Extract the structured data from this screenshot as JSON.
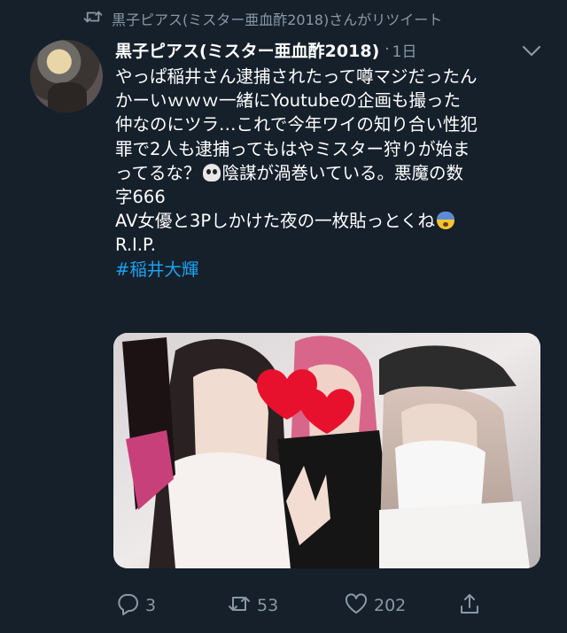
{
  "retweet_banner": {
    "text": "黒子ピアス(ミスター亜血酢2018)さんがリツイート",
    "icon": "retweet-icon"
  },
  "tweet": {
    "author_name": "黒子ピアス(ミスター亜血酢2018)",
    "separator": "·",
    "time": "1日",
    "text_lines": [
      "やっぱ稲井さん逮捕されたって噂マジだったん",
      "かーいｗｗｗ一緒にYoutubeの企画も撮った",
      "仲なのにツラ…これで今年ワイの知り合い性犯",
      "罪で2人も逮捕ってもはやミスター狩りが始ま",
      "ってるな？",
      "陰謀が渦巻いている。悪魔の数",
      "字666",
      "AV女優と3Pしかけた夜の一枚貼っとくね",
      "R.I.P."
    ],
    "hashtag": "#稲井大輝",
    "emojis": [
      "skull-emoji",
      "fearful-face-emoji"
    ]
  },
  "actions": {
    "reply_count": "3",
    "retweet_count": "53",
    "like_count": "202"
  },
  "colors": {
    "background": "#15202b",
    "text": "#ffffff",
    "muted": "#8899a6",
    "link": "#1da1f2"
  }
}
